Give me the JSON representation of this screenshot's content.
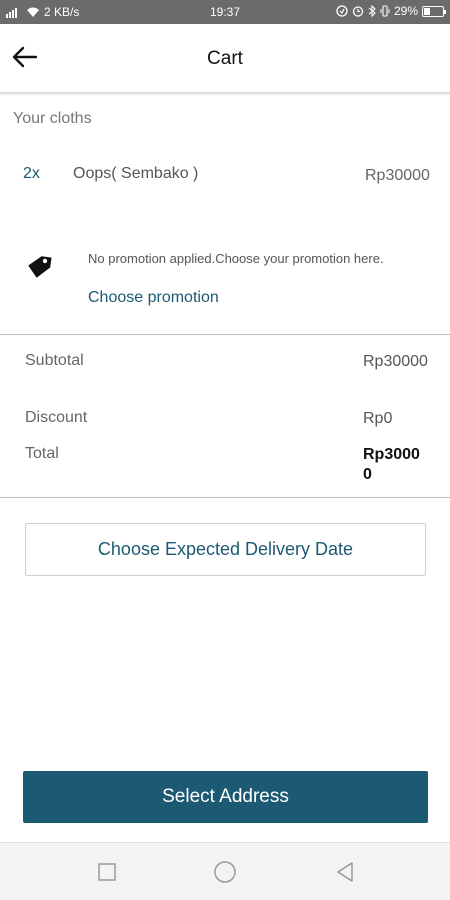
{
  "status_bar": {
    "network_speed": "2 KB/s",
    "time": "19:37",
    "battery": "29%"
  },
  "header": {
    "title": "Cart"
  },
  "cart": {
    "section_title": "Your cloths",
    "items": [
      {
        "quantity": "2x",
        "name": "Oops( Sembako )",
        "price": "Rp30000"
      }
    ]
  },
  "promotion": {
    "message": "No promotion applied.Choose your promotion here.",
    "link_label": "Choose promotion"
  },
  "summary": {
    "subtotal_label": "Subtotal",
    "subtotal_value": "Rp30000",
    "discount_label": "Discount",
    "discount_value": "Rp0",
    "total_label": "Total",
    "total_value": "Rp30000"
  },
  "actions": {
    "delivery_date_label": "Choose Expected Delivery Date",
    "select_address_label": "Select Address"
  },
  "colors": {
    "accent": "#1c5a73",
    "status_bar": "#6b6b6b"
  },
  "icons": {
    "back": "arrow-left-icon",
    "promotion": "tag-icon",
    "nav_recent": "square-icon",
    "nav_home": "circle-icon",
    "nav_back": "triangle-icon"
  }
}
